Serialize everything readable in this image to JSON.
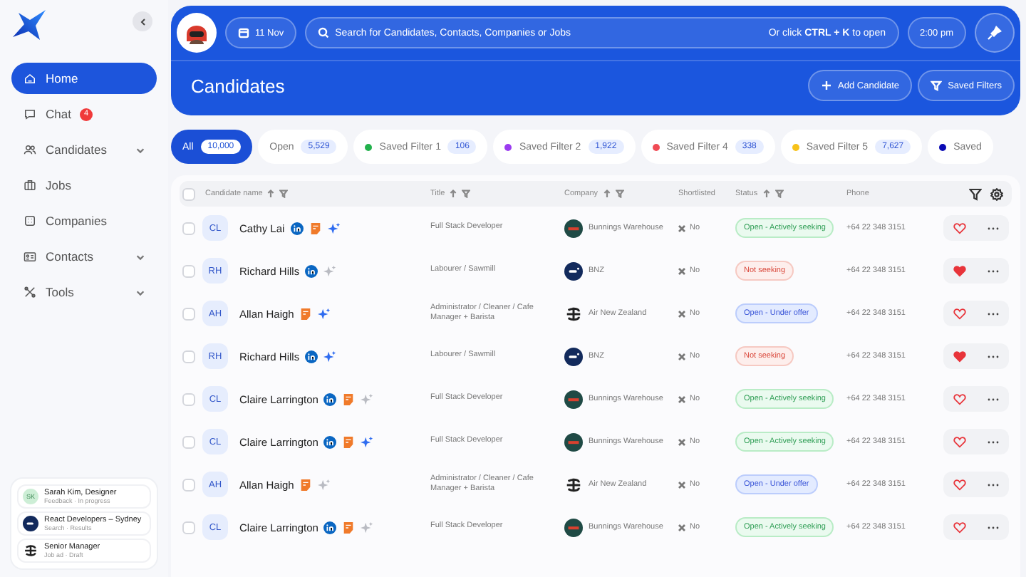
{
  "sidebar": {
    "items": [
      {
        "label": "Home",
        "selected": true,
        "expandable": false
      },
      {
        "label": "Chat",
        "selected": false,
        "badge": "4",
        "expandable": false
      },
      {
        "label": "Candidates",
        "selected": false,
        "expandable": true
      },
      {
        "label": "Jobs",
        "selected": false,
        "expandable": false
      },
      {
        "label": "Companies",
        "selected": false,
        "expandable": false
      },
      {
        "label": "Contacts",
        "selected": false,
        "expandable": true
      },
      {
        "label": "Tools",
        "selected": false,
        "expandable": true
      }
    ],
    "recent": [
      {
        "kind": "initials",
        "initials": "SK",
        "title": "Sarah Kim, Designer",
        "subtitle": "Feedback · In progress"
      },
      {
        "kind": "bnz",
        "title": "React Developers – Sydney",
        "subtitle": "Search · Results"
      },
      {
        "kind": "airnz",
        "title": "Senior Manager",
        "subtitle": "Job ad · Draft"
      }
    ]
  },
  "header": {
    "date": "11 Nov",
    "search_placeholder": "Search for Candidates, Contacts, Companies or Jobs",
    "shortcut": "Or click **CTRL + K** to open",
    "time": "2:00 pm",
    "title": "Candidates",
    "buttons": [
      "Add Candidate",
      "Saved Filters"
    ]
  },
  "filters": [
    {
      "label": "All",
      "count": "10,000",
      "selected": true
    },
    {
      "label": "Open",
      "count": "5,529",
      "selected": false
    },
    {
      "label": "Saved Filter 1",
      "count": "106",
      "selected": false,
      "color": "#22b14c"
    },
    {
      "label": "Saved Filter 2",
      "count": "1,922",
      "selected": false,
      "color": "#9b3cf0"
    },
    {
      "label": "Saved Filter 4",
      "count": "338",
      "selected": false,
      "color": "#f04b55"
    },
    {
      "label": "Saved Filter 5",
      "count": "7,627",
      "selected": false,
      "color": "#f7c21a"
    },
    {
      "label": "Saved",
      "selected": false,
      "color": "#0a0ab4"
    }
  ],
  "table": {
    "all_checked": false,
    "columns": [
      "Candidate name",
      "Title",
      "Company",
      "Shortlisted",
      "Status",
      "Phone"
    ],
    "rows": [
      {
        "checked": false,
        "initials": "CL",
        "name": "Cathy Lai",
        "linkedin": true,
        "cv": true,
        "ai_active": true,
        "title": "Full Stack Developer",
        "company": {
          "name": "Bunnings Warehouse",
          "kind": "bunnings"
        },
        "shortlisted": "No",
        "status": {
          "label": "Open - Actively seeking",
          "kind": "active"
        },
        "phone": "+64 22 348 3151",
        "liked": false
      },
      {
        "checked": false,
        "initials": "RH",
        "name": "Richard Hills",
        "linkedin": true,
        "cv": false,
        "ai_active": false,
        "title": "Labourer / Sawmill",
        "company": {
          "name": "BNZ",
          "kind": "bnz"
        },
        "shortlisted": "No",
        "status": {
          "label": "Not seeking",
          "kind": "not"
        },
        "phone": "+64 22 348 3151",
        "liked": true
      },
      {
        "checked": false,
        "initials": "AH",
        "name": "Allan Haigh",
        "linkedin": false,
        "cv": true,
        "ai_active": true,
        "title": "Administrator / Cleaner / Cafe Manager + Barista",
        "company": {
          "name": "Air New Zealand",
          "kind": "airnz"
        },
        "shortlisted": "No",
        "status": {
          "label": "Open - Under offer",
          "kind": "offer"
        },
        "phone": "+64 22 348 3151",
        "liked": false
      },
      {
        "checked": false,
        "initials": "RH",
        "name": "Richard Hills",
        "linkedin": true,
        "cv": false,
        "ai_active": true,
        "title": "Labourer / Sawmill",
        "company": {
          "name": "BNZ",
          "kind": "bnz"
        },
        "shortlisted": "No",
        "status": {
          "label": "Not seeking",
          "kind": "not"
        },
        "phone": "+64 22 348 3151",
        "liked": true
      },
      {
        "checked": false,
        "initials": "CL",
        "name": "Claire Larrington",
        "linkedin": true,
        "cv": true,
        "ai_active": false,
        "title": "Full Stack Developer",
        "company": {
          "name": "Bunnings Warehouse",
          "kind": "bunnings"
        },
        "shortlisted": "No",
        "status": {
          "label": "Open - Actively seeking",
          "kind": "active"
        },
        "phone": "+64 22 348 3151",
        "liked": false
      },
      {
        "checked": false,
        "initials": "CL",
        "name": "Claire Larrington",
        "linkedin": true,
        "cv": true,
        "ai_active": true,
        "title": "Full Stack Developer",
        "company": {
          "name": "Bunnings Warehouse",
          "kind": "bunnings"
        },
        "shortlisted": "No",
        "status": {
          "label": "Open - Actively seeking",
          "kind": "active"
        },
        "phone": "+64 22 348 3151",
        "liked": false
      },
      {
        "checked": false,
        "initials": "AH",
        "name": "Allan Haigh",
        "linkedin": false,
        "cv": true,
        "ai_active": false,
        "title": "Administrator / Cleaner / Cafe Manager + Barista",
        "company": {
          "name": "Air New Zealand",
          "kind": "airnz"
        },
        "shortlisted": "No",
        "status": {
          "label": "Open - Under offer",
          "kind": "offer"
        },
        "phone": "+64 22 348 3151",
        "liked": false
      },
      {
        "checked": false,
        "initials": "CL",
        "name": "Claire Larrington",
        "linkedin": true,
        "cv": true,
        "ai_active": false,
        "title": "Full Stack Developer",
        "company": {
          "name": "Bunnings Warehouse",
          "kind": "bunnings"
        },
        "shortlisted": "No",
        "status": {
          "label": "Open - Actively seeking",
          "kind": "active"
        },
        "phone": "+64 22 348 3151",
        "liked": false
      }
    ]
  }
}
